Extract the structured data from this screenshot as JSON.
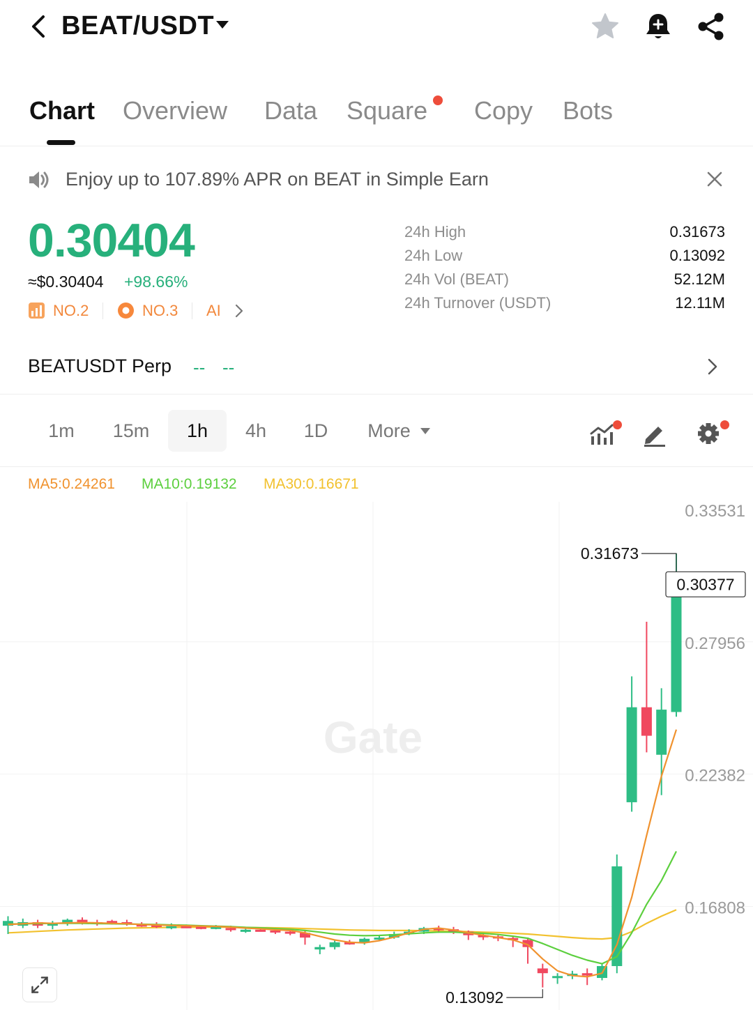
{
  "header": {
    "pair": "BEAT/USDT",
    "icons": [
      "back-icon",
      "star-icon",
      "bell-add-icon",
      "share-icon"
    ]
  },
  "tabs": [
    {
      "label": "Chart",
      "active": true
    },
    {
      "label": "Overview",
      "active": false
    },
    {
      "label": "Data",
      "active": false
    },
    {
      "label": "Square",
      "active": false,
      "dot": true
    },
    {
      "label": "Copy",
      "active": false
    },
    {
      "label": "Bots",
      "active": false
    }
  ],
  "banner": {
    "text": "Enjoy up to 107.89% APR on BEAT in Simple Earn"
  },
  "price": {
    "last": "0.30404",
    "usd": "≈$0.30404",
    "change": "+98.66%",
    "rank1": "NO.2",
    "rank2": "NO.3",
    "ai": "AI"
  },
  "stats": [
    {
      "label": "24h High",
      "value": "0.31673"
    },
    {
      "label": "24h Low",
      "value": "0.13092"
    },
    {
      "label": "24h Vol (BEAT)",
      "value": "52.12M"
    },
    {
      "label": "24h Turnover (USDT)",
      "value": "12.11M"
    }
  ],
  "perp": {
    "label": "BEATUSDT Perp",
    "price": "--",
    "change": "--"
  },
  "intervals": {
    "items": [
      "1m",
      "15m",
      "1h",
      "4h",
      "1D",
      "More"
    ],
    "active": "1h"
  },
  "ma": {
    "ma5": "MA5:0.24261",
    "ma10": "MA10:0.19132",
    "ma30": "MA30:0.16671"
  },
  "colors": {
    "up": "#2ebd85",
    "down": "#f0485f",
    "ma5": "#f0922e",
    "ma10": "#5ccf3e",
    "ma30": "#f2c12e",
    "accent_green": "#27b07b",
    "rank_orange": "#f2883c"
  },
  "chart_data": {
    "type": "candlestick",
    "interval": "1h",
    "ylim": [
      0.1245,
      0.3385
    ],
    "y_ticks": [
      "0.33531",
      "0.27956",
      "0.22382",
      "0.16808"
    ],
    "y_tick_values": [
      0.33531,
      0.27956,
      0.22382,
      0.16808
    ],
    "high_label": "0.31673",
    "high_value": 0.31673,
    "low_label": "0.13092",
    "low_value": 0.13092,
    "last_label": "0.30377",
    "last_value": 0.30377,
    "watermark": "Gate",
    "candles": [
      [
        0.16,
        0.162,
        0.164,
        0.1565
      ],
      [
        0.16,
        0.1615,
        0.163,
        0.159
      ],
      [
        0.1615,
        0.16,
        0.1625,
        0.159
      ],
      [
        0.16,
        0.161,
        0.162,
        0.1585
      ],
      [
        0.161,
        0.1625,
        0.163,
        0.16
      ],
      [
        0.1625,
        0.1615,
        0.1635,
        0.1605
      ],
      [
        0.1615,
        0.161,
        0.1625,
        0.16
      ],
      [
        0.162,
        0.1615,
        0.1625,
        0.1605
      ],
      [
        0.1615,
        0.161,
        0.1625,
        0.16
      ],
      [
        0.1605,
        0.1603,
        0.1615,
        0.1595
      ],
      [
        0.1603,
        0.16,
        0.1615,
        0.159
      ],
      [
        0.1595,
        0.1598,
        0.161,
        0.1585
      ],
      [
        0.1598,
        0.1595,
        0.1605,
        0.159
      ],
      [
        0.1595,
        0.1592,
        0.16,
        0.1585
      ],
      [
        0.1592,
        0.1595,
        0.1603,
        0.1585
      ],
      [
        0.159,
        0.1585,
        0.16,
        0.1575
      ],
      [
        0.158,
        0.1583,
        0.159,
        0.157
      ],
      [
        0.1583,
        0.158,
        0.159,
        0.1575
      ],
      [
        0.158,
        0.1575,
        0.159,
        0.1565
      ],
      [
        0.1575,
        0.157,
        0.1585,
        0.156
      ],
      [
        0.157,
        0.155,
        0.158,
        0.152
      ],
      [
        0.15,
        0.151,
        0.152,
        0.148
      ],
      [
        0.151,
        0.153,
        0.154,
        0.15
      ],
      [
        0.153,
        0.1528,
        0.154,
        0.152
      ],
      [
        0.1528,
        0.1545,
        0.155,
        0.152
      ],
      [
        0.1545,
        0.155,
        0.156,
        0.154
      ],
      [
        0.155,
        0.1565,
        0.1575,
        0.1545
      ],
      [
        0.1565,
        0.1575,
        0.1585,
        0.156
      ],
      [
        0.1575,
        0.159,
        0.1595,
        0.1565
      ],
      [
        0.159,
        0.1585,
        0.16,
        0.157
      ],
      [
        0.1585,
        0.1575,
        0.1595,
        0.1565
      ],
      [
        0.1575,
        0.156,
        0.158,
        0.154
      ],
      [
        0.156,
        0.1555,
        0.1565,
        0.154
      ],
      [
        0.1555,
        0.1548,
        0.1565,
        0.1535
      ],
      [
        0.1548,
        0.154,
        0.1555,
        0.151
      ],
      [
        0.154,
        0.151,
        0.155,
        0.144
      ],
      [
        0.142,
        0.14,
        0.144,
        0.134
      ],
      [
        0.138,
        0.1388,
        0.14,
        0.1355
      ],
      [
        0.1388,
        0.1398,
        0.141,
        0.1375
      ],
      [
        0.14,
        0.139,
        0.142,
        0.135
      ],
      [
        0.138,
        0.143,
        0.144,
        0.137
      ],
      [
        0.143,
        0.185,
        0.19,
        0.14
      ],
      [
        0.212,
        0.252,
        0.265,
        0.208
      ],
      [
        0.252,
        0.24,
        0.288,
        0.233
      ],
      [
        0.232,
        0.251,
        0.26,
        0.215
      ],
      [
        0.25,
        0.3038,
        0.3167,
        0.248
      ]
    ],
    "ma5": [
      [
        0.1605,
        0.1608,
        0.1612,
        0.161,
        0.1612,
        0.1613,
        0.1612,
        0.161,
        0.1608,
        0.1605,
        0.1603,
        0.1601,
        0.16,
        0.1598,
        0.1597,
        0.1594,
        0.159,
        0.1587,
        0.1583,
        0.158,
        0.157,
        0.1555,
        0.154,
        0.153,
        0.1528,
        0.1537,
        0.1552,
        0.157,
        0.1585,
        0.159,
        0.1582,
        0.157,
        0.156,
        0.155,
        0.154,
        0.152,
        0.146,
        0.141,
        0.139,
        0.1385,
        0.14,
        0.152,
        0.172,
        0.198,
        0.223,
        0.2426
      ]
    ],
    "ma10": [
      [
        0.1607,
        0.1608,
        0.1609,
        0.161,
        0.161,
        0.161,
        0.1609,
        0.1608,
        0.1607,
        0.1606,
        0.1605,
        0.1603,
        0.1602,
        0.16,
        0.1598,
        0.1596,
        0.1593,
        0.1591,
        0.1588,
        0.1585,
        0.158,
        0.1573,
        0.1565,
        0.156,
        0.1558,
        0.1559,
        0.1562,
        0.1566,
        0.157,
        0.1573,
        0.1573,
        0.157,
        0.1568,
        0.1563,
        0.1556,
        0.1547,
        0.1525,
        0.15,
        0.1475,
        0.1455,
        0.144,
        0.147,
        0.157,
        0.169,
        0.179,
        0.1913
      ]
    ],
    "ma30": [
      [
        0.157,
        0.1573,
        0.1576,
        0.1579,
        0.1582,
        0.1584,
        0.1586,
        0.1588,
        0.159,
        0.1591,
        0.1592,
        0.1593,
        0.1594,
        0.1594,
        0.1594,
        0.1594,
        0.1593,
        0.1592,
        0.1591,
        0.159,
        0.1588,
        0.1586,
        0.1584,
        0.1582,
        0.1581,
        0.158,
        0.158,
        0.158,
        0.1579,
        0.1578,
        0.1577,
        0.1575,
        0.1573,
        0.1571,
        0.1568,
        0.1565,
        0.156,
        0.1555,
        0.155,
        0.1546,
        0.1544,
        0.155,
        0.1575,
        0.161,
        0.164,
        0.1667
      ]
    ]
  }
}
